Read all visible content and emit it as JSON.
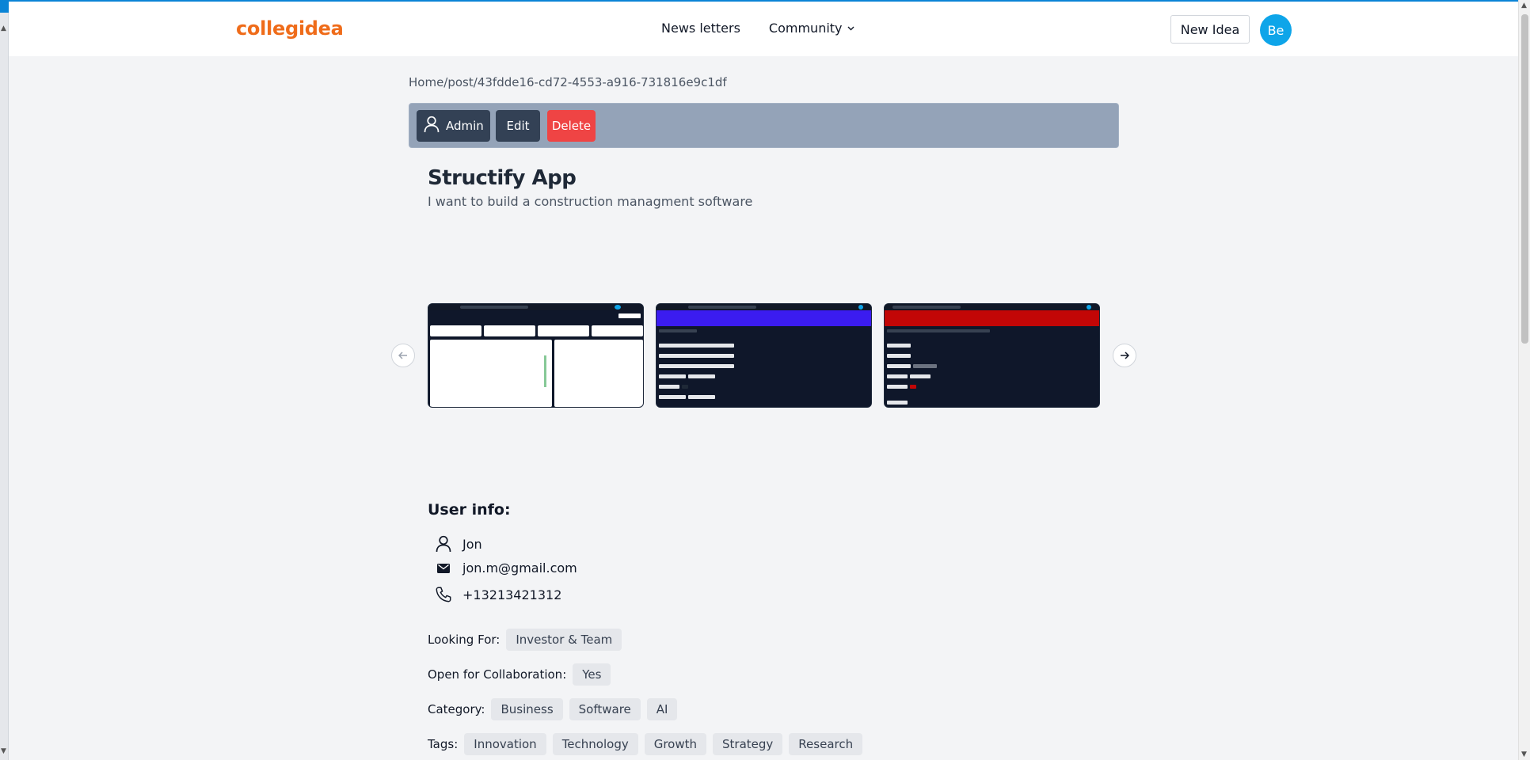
{
  "header": {
    "logo": "collegidea",
    "nav": {
      "newsletters": "News letters",
      "community": "Community"
    },
    "new_idea_label": "New Idea",
    "avatar_initials": "Be"
  },
  "breadcrumb": {
    "home": "Home",
    "sep1": "/",
    "post": "post",
    "sep2": "/",
    "id": "43fdde16-cd72-4553-a916-731816e9c1df"
  },
  "admin_bar": {
    "admin_label": "Admin",
    "edit_label": "Edit",
    "delete_label": "Delete"
  },
  "post": {
    "title": "Structify App",
    "description": "I want to build a construction managment software"
  },
  "user_info": {
    "heading": "User info:",
    "name": "Jon",
    "email": "jon.m@gmail.com",
    "phone": "+13213421312"
  },
  "meta": {
    "looking_for_label": "Looking For:",
    "looking_for_value": "Investor & Team",
    "collab_label": "Open for Collaboration:",
    "collab_value": "Yes",
    "category_label": "Category:",
    "categories": [
      "Business",
      "Software",
      "AI"
    ],
    "tags_label": "Tags:",
    "tags": [
      "Innovation",
      "Technology",
      "Growth",
      "Strategy",
      "Research"
    ]
  },
  "colors": {
    "logo": "#ef6c1a",
    "avatar": "#0ea5e9",
    "admin_bar": "#94a3b8",
    "button_dark": "#334155",
    "delete": "#ef4444"
  },
  "icons": {
    "admin": "user-icon",
    "name": "user-icon",
    "email": "mail-icon",
    "phone": "phone-icon",
    "prev": "arrow-left-icon",
    "next": "arrow-right-icon",
    "community": "chevron-down-icon"
  }
}
